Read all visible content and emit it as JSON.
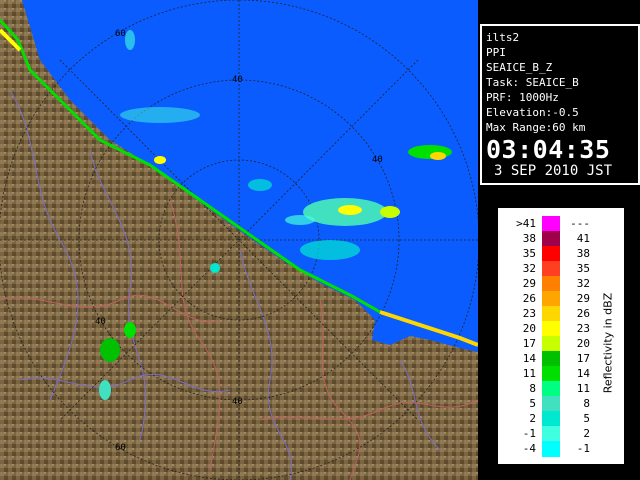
{
  "info": {
    "station": "ilts2",
    "scan_type": "PPI",
    "product": "SEAICE_B_Z",
    "task": "Task: SEAICE_B",
    "prf": "PRF: 1000Hz",
    "elevation": "Elevation:-0.5",
    "max_range": "Max Range:60 km",
    "time": "03:04:35",
    "date": "3 SEP 2010 JST"
  },
  "range_labels": [
    "60",
    "40",
    "40",
    "40",
    "40",
    "60"
  ],
  "legend": {
    "title": "Reflectivity in dBZ",
    "rows": [
      {
        "lo": ">41",
        "hi": "---",
        "color": "#ff00ff"
      },
      {
        "lo": "38",
        "hi": "41",
        "color": "#a0004a"
      },
      {
        "lo": "35",
        "hi": "38",
        "color": "#ff0000"
      },
      {
        "lo": "32",
        "hi": "35",
        "color": "#ff4020"
      },
      {
        "lo": "29",
        "hi": "32",
        "color": "#ff7f00"
      },
      {
        "lo": "26",
        "hi": "29",
        "color": "#ffa500"
      },
      {
        "lo": "23",
        "hi": "26",
        "color": "#ffd700"
      },
      {
        "lo": "20",
        "hi": "23",
        "color": "#ffff00"
      },
      {
        "lo": "17",
        "hi": "20",
        "color": "#c8ff00"
      },
      {
        "lo": "14",
        "hi": "17",
        "color": "#00c000"
      },
      {
        "lo": "11",
        "hi": "14",
        "color": "#00e000"
      },
      {
        "lo": "8",
        "hi": "11",
        "color": "#00ff80"
      },
      {
        "lo": "5",
        "hi": "8",
        "color": "#40e0c0"
      },
      {
        "lo": "2",
        "hi": "5",
        "color": "#00e8d0"
      },
      {
        "lo": "-1",
        "hi": "2",
        "color": "#40ffe0"
      },
      {
        "lo": "-4",
        "hi": "-1",
        "color": "#00ffff"
      }
    ]
  },
  "colors": {
    "sea": "#0a5cff",
    "land": "#7a6540",
    "range_ring": "#222222"
  }
}
